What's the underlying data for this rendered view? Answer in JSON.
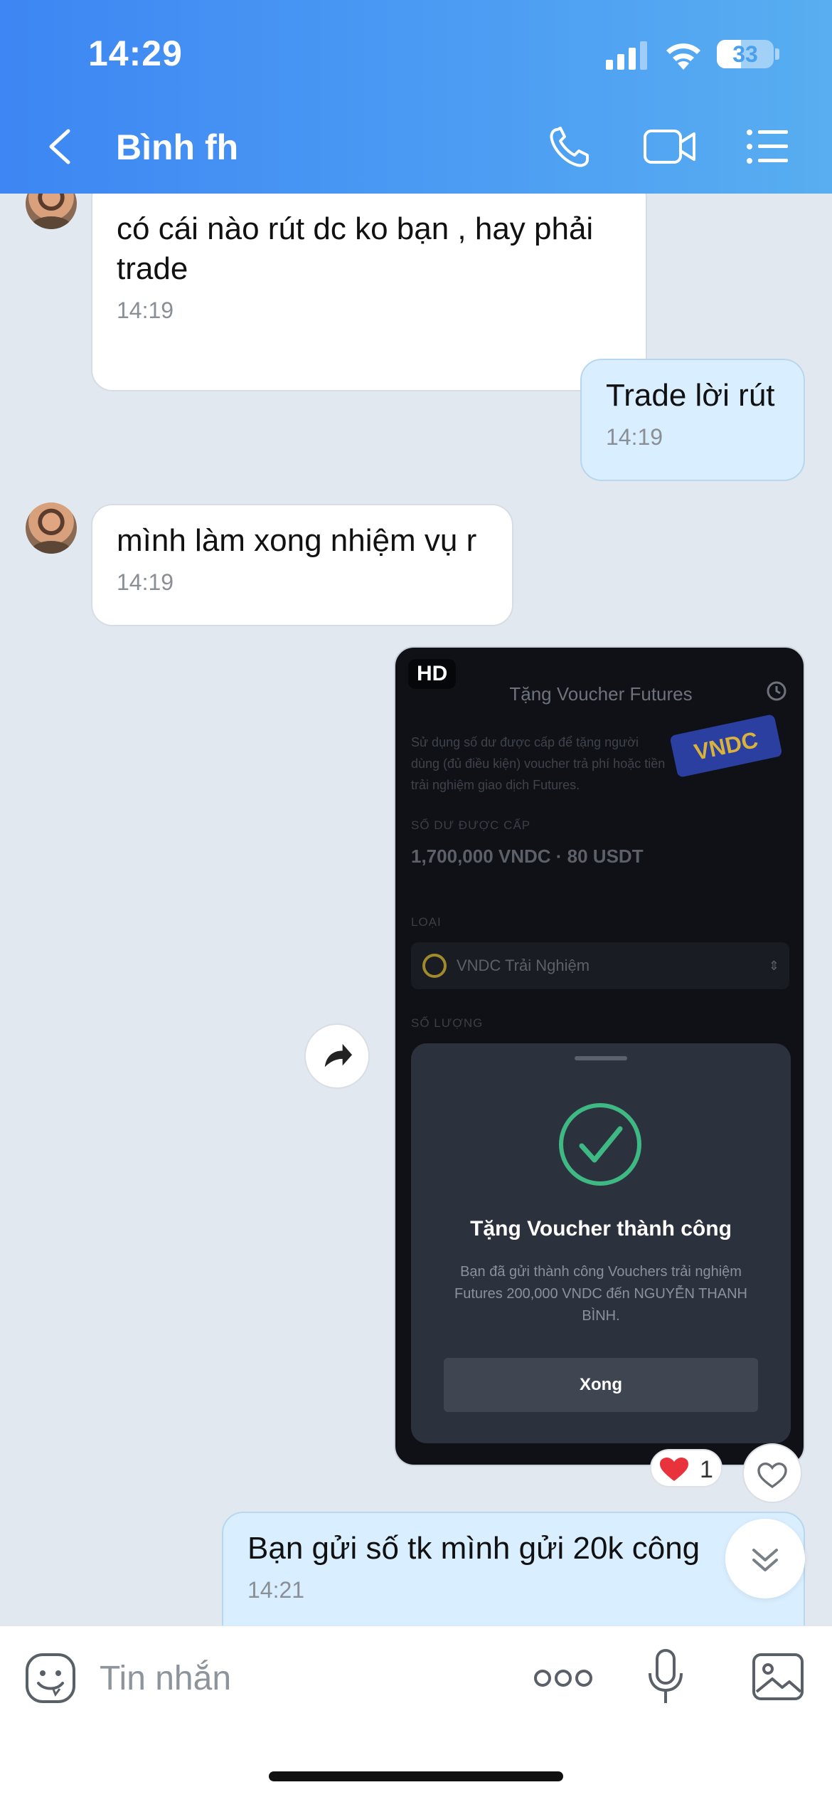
{
  "status_bar": {
    "time": "14:29",
    "battery": "33"
  },
  "header": {
    "contact_name": "Bình fh"
  },
  "messages": [
    {
      "direction": "in",
      "text": "có cái nào rút dc ko bạn , hay phải trade",
      "time": "14:19"
    },
    {
      "direction": "out",
      "text": "Trade lời rút",
      "time": "14:19"
    },
    {
      "direction": "in",
      "text": "mình làm xong nhiệm vụ r",
      "time": "14:19"
    },
    {
      "direction": "out",
      "text": "Bạn gửi số tk mình gửi 20k công",
      "time": "14:21"
    }
  ],
  "image_message": {
    "badge": "HD",
    "screen_title": "Tặng Voucher Futures",
    "description": "Sử dụng số dư được cấp để tặng người dùng (đủ điều kiện) voucher trả phí hoặc tiền trải nghiệm giao dịch Futures.",
    "logo_text": "VNDC",
    "balance_label": "SỐ DƯ ĐƯỢC CẤP",
    "balance_value": "1,700,000 VNDC · 80 USDT",
    "type_label": "LOẠI",
    "type_value": "VNDC Trải Nghiệm",
    "qty_label": "SỐ LƯỢNG",
    "sheet_title": "Tặng Voucher thành công",
    "sheet_body": "Bạn đã gửi thành công Vouchers trải nghiệm Futures 200,000 VNDC đến NGUYỄN THANH BÌNH.",
    "sheet_button": "Xong",
    "reaction_count": "1"
  },
  "composer": {
    "placeholder": "Tin nhắn"
  },
  "colors": {
    "header": "#4d9ef3",
    "outgoing_bubble": "#d9efff",
    "incoming_bubble": "#ffffff",
    "success": "#3fb984",
    "reaction_heart": "#e8323c"
  },
  "icons": [
    "back-arrow-icon",
    "phone-icon",
    "video-icon",
    "menu-list-icon",
    "share-icon",
    "heart-icon",
    "chevron-double-down-icon",
    "sticker-icon",
    "more-dots-icon",
    "microphone-icon",
    "image-icon"
  ]
}
